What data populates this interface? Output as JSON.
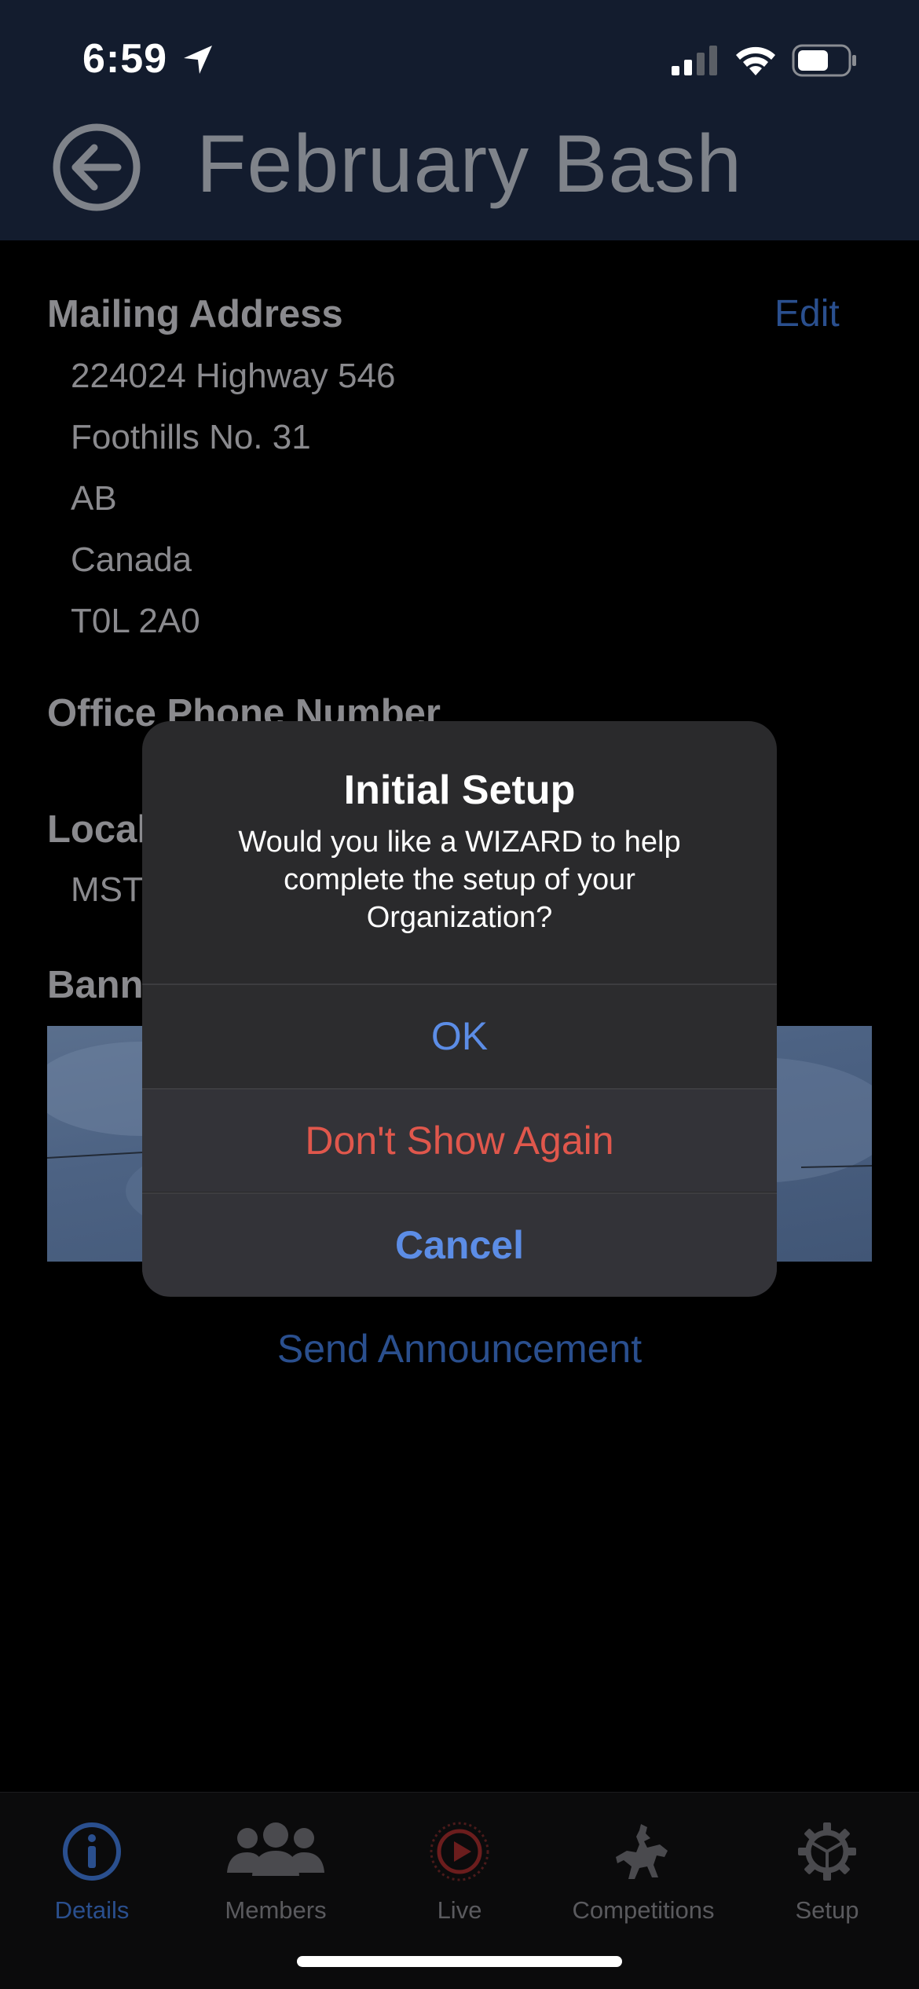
{
  "status_bar": {
    "time": "6:59"
  },
  "header": {
    "title": "February Bash"
  },
  "details": {
    "mailing_address_label": "Mailing Address",
    "edit_label": "Edit",
    "address_lines": [
      "224024 Highway 546",
      "Foothills No. 31",
      "AB",
      "Canada",
      "T0L 2A0"
    ],
    "office_phone_label": "Office Phone Number",
    "local_label": "Local",
    "local_value": "MST",
    "banner_label": "Bann",
    "send_announcement": "Send Announcement"
  },
  "alert": {
    "title": "Initial Setup",
    "message": "Would you like a WIZARD to help complete the setup of your Organization?",
    "ok_label": "OK",
    "dont_show_label": "Don't Show Again",
    "cancel_label": "Cancel"
  },
  "tabbar": {
    "tabs": [
      {
        "label": "Details",
        "icon": "info-icon",
        "active": true
      },
      {
        "label": "Members",
        "icon": "members-icon",
        "active": false
      },
      {
        "label": "Live",
        "icon": "live-play-icon",
        "active": false
      },
      {
        "label": "Competitions",
        "icon": "rodeo-icon",
        "active": false
      },
      {
        "label": "Setup",
        "icon": "gear-icon",
        "active": false
      }
    ]
  },
  "colors": {
    "header_bg": "#131c2e",
    "link_dimmed": "#2a4f8e",
    "alert_action": "#5c8de6",
    "alert_destructive": "#e0574c"
  }
}
